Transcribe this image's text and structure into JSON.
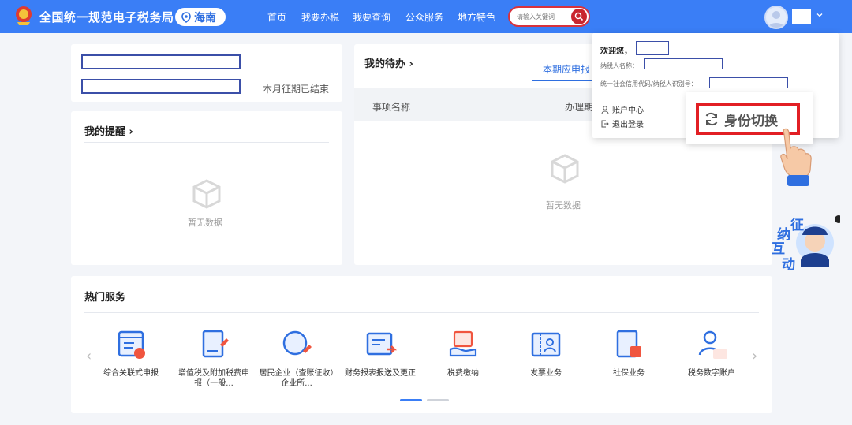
{
  "header": {
    "site_title": "全国统一规范电子税务局",
    "region": "海南",
    "nav": [
      "首页",
      "我要办税",
      "我要查询",
      "公众服务",
      "地方特色"
    ],
    "search_placeholder": "请输入关键词"
  },
  "summary": {
    "status_text": "本月征期已结束"
  },
  "reminders": {
    "title": "我的提醒",
    "chevron": "›",
    "empty_text": "暂无数据"
  },
  "todo": {
    "title": "我的待办",
    "chevron": "›",
    "active_tab": "本期应申报",
    "col_item": "事项名称",
    "col_deadline": "办理期",
    "empty_text": "暂无数据"
  },
  "hot_services": {
    "title": "热门服务",
    "prev": "‹",
    "next": "›",
    "items": [
      {
        "label": "综合关联式申报",
        "icon": "form-icon"
      },
      {
        "label": "增值税及附加税费申报（一般...",
        "icon": "vat-icon"
      },
      {
        "label": "居民企业（查账征收）企业所...",
        "icon": "enterprise-icon"
      },
      {
        "label": "财务报表报送及更正",
        "icon": "report-icon"
      },
      {
        "label": "税费缴纳",
        "icon": "payment-icon"
      },
      {
        "label": "发票业务",
        "icon": "invoice-icon"
      },
      {
        "label": "社保业务",
        "icon": "social-security-icon"
      },
      {
        "label": "税务数字账户",
        "icon": "digital-account-icon"
      }
    ]
  },
  "user_menu": {
    "welcome": "欢迎您，",
    "taxpayer_name_label": "纳税人名称：",
    "credit_code_label": "统一社会信用代码/纳税人识别号：",
    "account_center": "账户中心",
    "logout": "退出登录",
    "switch_identity": "身份切换"
  },
  "mascot": {
    "chars": [
      "征",
      "纳",
      "互",
      "动"
    ]
  },
  "colors": {
    "header_blue": "#3a7ef6",
    "accent_red": "#e21f24",
    "link_blue": "#2f6fe0"
  }
}
